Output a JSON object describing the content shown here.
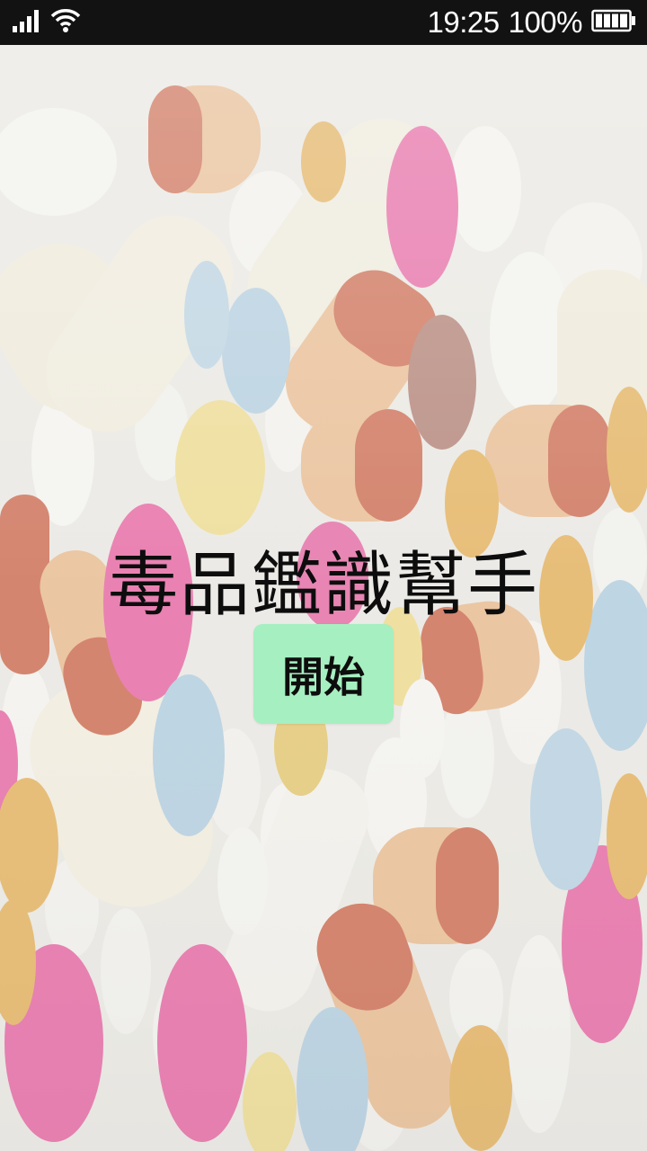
{
  "status_bar": {
    "time": "19:25",
    "battery_percent": "100%",
    "battery_level": 1.0,
    "icons": [
      "signal-icon",
      "wifi-icon",
      "battery-icon"
    ]
  },
  "background": {
    "description_icon": "pills-background",
    "palette": {
      "white": "#f4f3ef",
      "cream": "#efe9d8",
      "pink": "#e5559a",
      "blue": "#aac9de",
      "yellow": "#eed983",
      "orange": "#e2a94a",
      "red": "#c85a3d",
      "tan": "#e8b585",
      "brown": "#a87064"
    }
  },
  "main": {
    "title": "毒品鑑識幫手",
    "start_label": "開始",
    "start_color": "#a6efc1"
  }
}
